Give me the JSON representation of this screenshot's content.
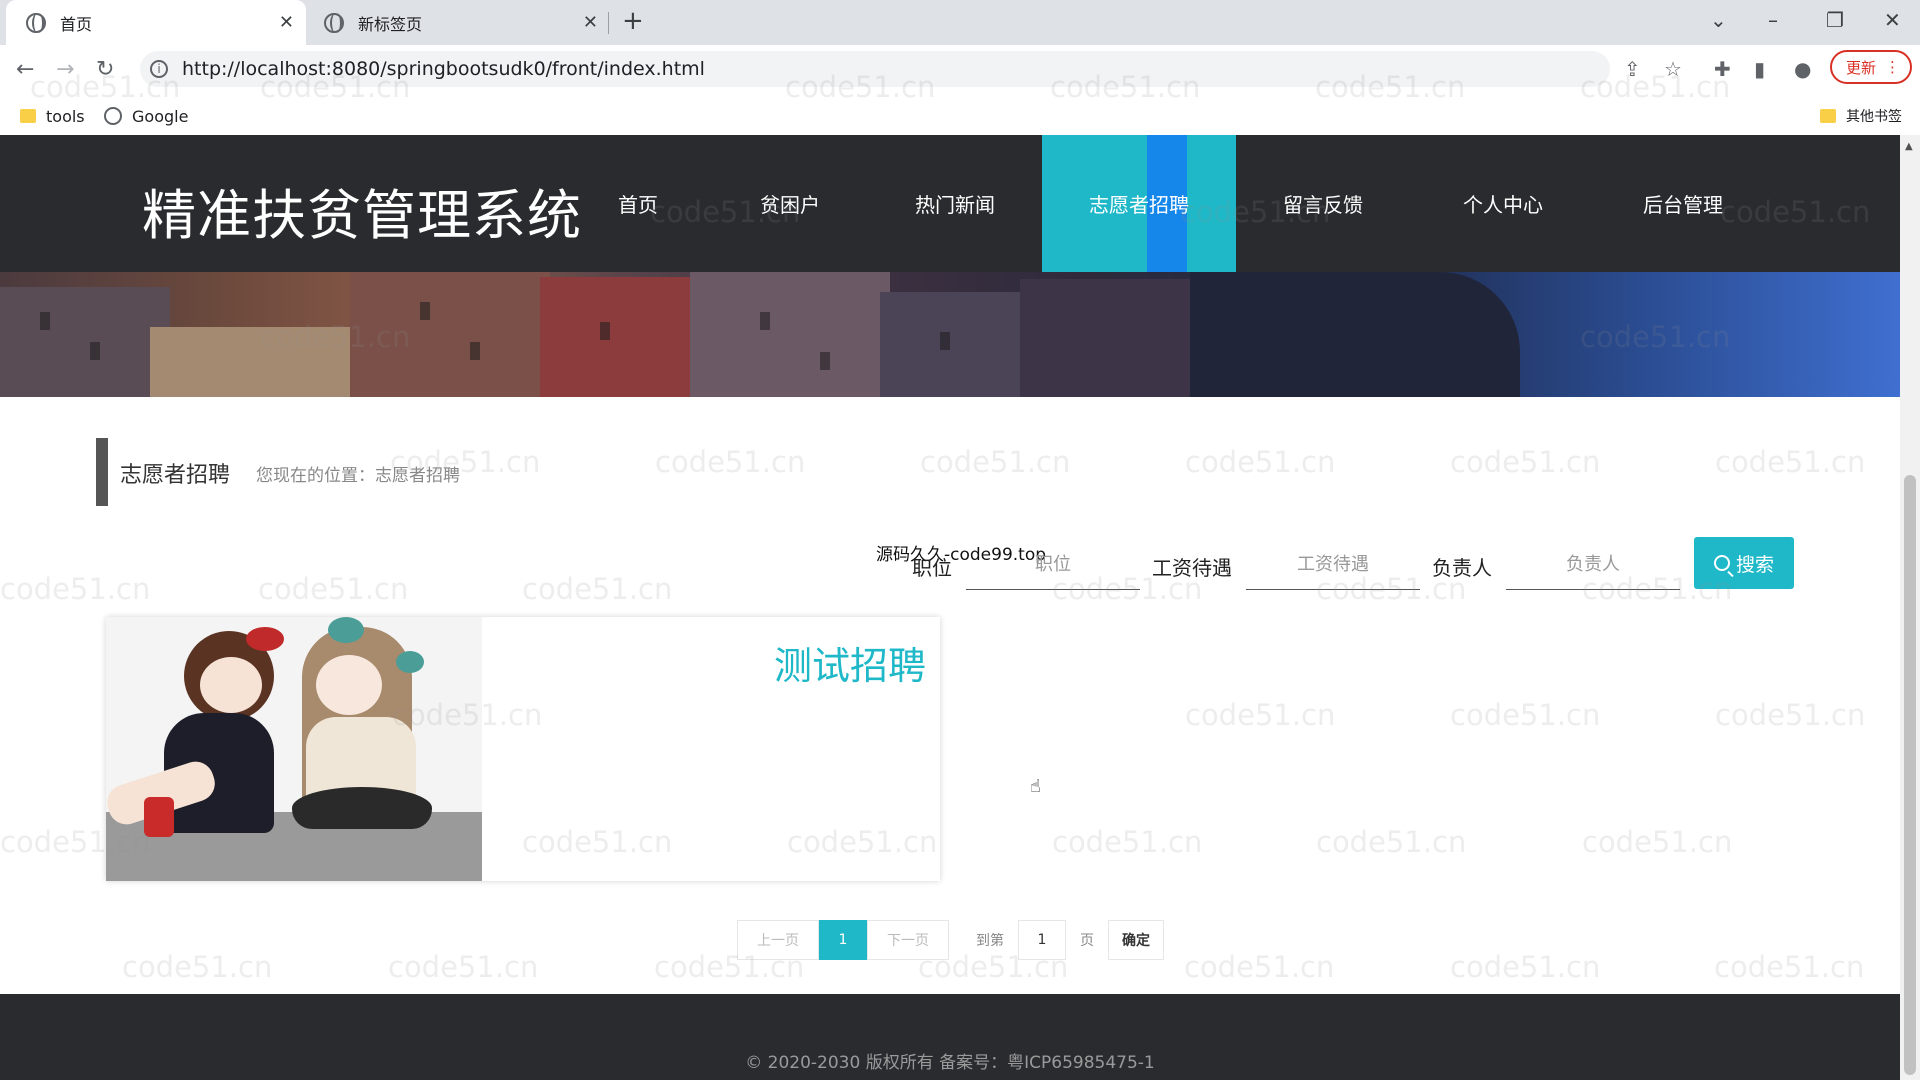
{
  "browser": {
    "tabs": [
      {
        "title": "首页"
      },
      {
        "title": "新标签页"
      }
    ],
    "close_glyph": "✕",
    "new_tab_glyph": "+",
    "url": "http://localhost:8080/springbootsudk0/front/index.html",
    "update_label": "更新",
    "bookmarks": [
      {
        "label": "tools"
      },
      {
        "label": "Google"
      }
    ],
    "other_bookmarks": "其他书签"
  },
  "site": {
    "brand": "精准扶贫管理系统",
    "nav": [
      {
        "label": "首页"
      },
      {
        "label": "贫困户"
      },
      {
        "label": "热门新闻"
      },
      {
        "label": "志愿者招聘",
        "active": true
      },
      {
        "label": "留言反馈"
      },
      {
        "label": "个人中心"
      },
      {
        "label": "后台管理"
      }
    ],
    "accent_color": "#1fb8c8"
  },
  "breadcrumb": {
    "title": "志愿者招聘",
    "location": "您现在的位置：志愿者招聘"
  },
  "overlay_text": "源码久久-code99.top",
  "search": {
    "position_label": "职位",
    "position_placeholder": "职位",
    "salary_label": "工资待遇",
    "salary_placeholder": "工资待遇",
    "owner_label": "负责人",
    "owner_placeholder": "负责人",
    "button_label": "搜索"
  },
  "cards": [
    {
      "title": "测试招聘"
    }
  ],
  "pagination": {
    "prev": "上一页",
    "current": "1",
    "next": "下一页",
    "goto_prefix": "到第",
    "goto_value": "1",
    "goto_suffix": "页",
    "confirm": "确定"
  },
  "footer": {
    "text": "© 2020-2030 版权所有 备案号：粤ICP65985475-1"
  },
  "watermark": "code51.cn"
}
